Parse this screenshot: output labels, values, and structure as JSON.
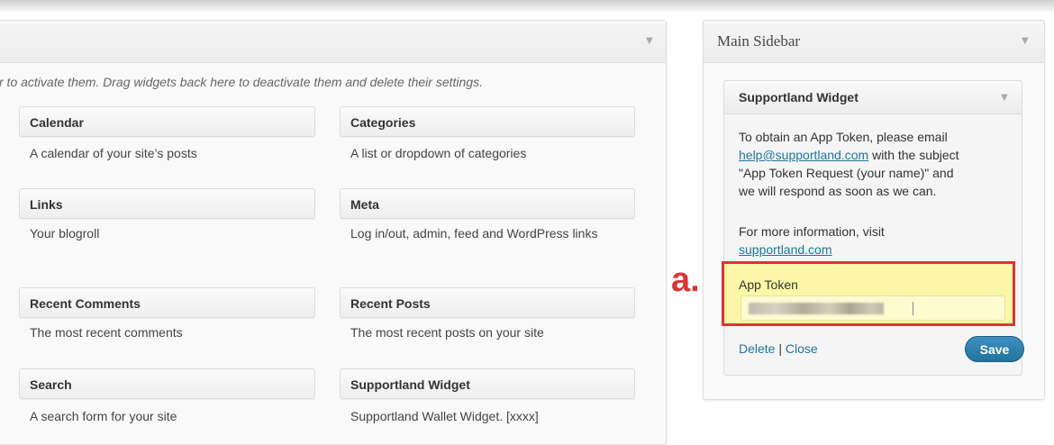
{
  "available": {
    "description": "r to activate them. Drag widgets back here to deactivate them and delete their settings.",
    "widgets": [
      {
        "title": "Calendar",
        "desc": "A calendar of your site’s posts"
      },
      {
        "title": "Categories",
        "desc": "A list or dropdown of categories"
      },
      {
        "title": "Links",
        "desc": "Your blogroll"
      },
      {
        "title": "Meta",
        "desc": "Log in/out, admin, feed and WordPress links"
      },
      {
        "title": "Recent Comments",
        "desc": "The most recent comments"
      },
      {
        "title": "Recent Posts",
        "desc": "The most recent posts on your site"
      },
      {
        "title": "Search",
        "desc": "A search form for your site"
      },
      {
        "title": "Supportland Widget",
        "desc": "Supportland Wallet Widget. [xxxx]"
      }
    ]
  },
  "sidebar": {
    "title": "Main Sidebar",
    "widget": {
      "title": "Supportland Widget",
      "info_pre": "To obtain an App Token, please email",
      "email": "help@supportland.com",
      "info_mid": " with the subject",
      "info_line3": "\"App Token Request (your name)\" and",
      "info_line4": "we will respond as soon as we can.",
      "more_info": "For more information, visit",
      "site_link": "supportland.com",
      "token_label": "App Token",
      "delete_label": "Delete",
      "separator": " | ",
      "close_label": "Close",
      "save_label": "Save"
    }
  },
  "annotation": {
    "label": "a."
  },
  "icons": {
    "toggle": "triangle-down-icon"
  },
  "colors": {
    "link": "#21759b",
    "highlight": "#fbf7a6",
    "annotation": "#d93636"
  }
}
